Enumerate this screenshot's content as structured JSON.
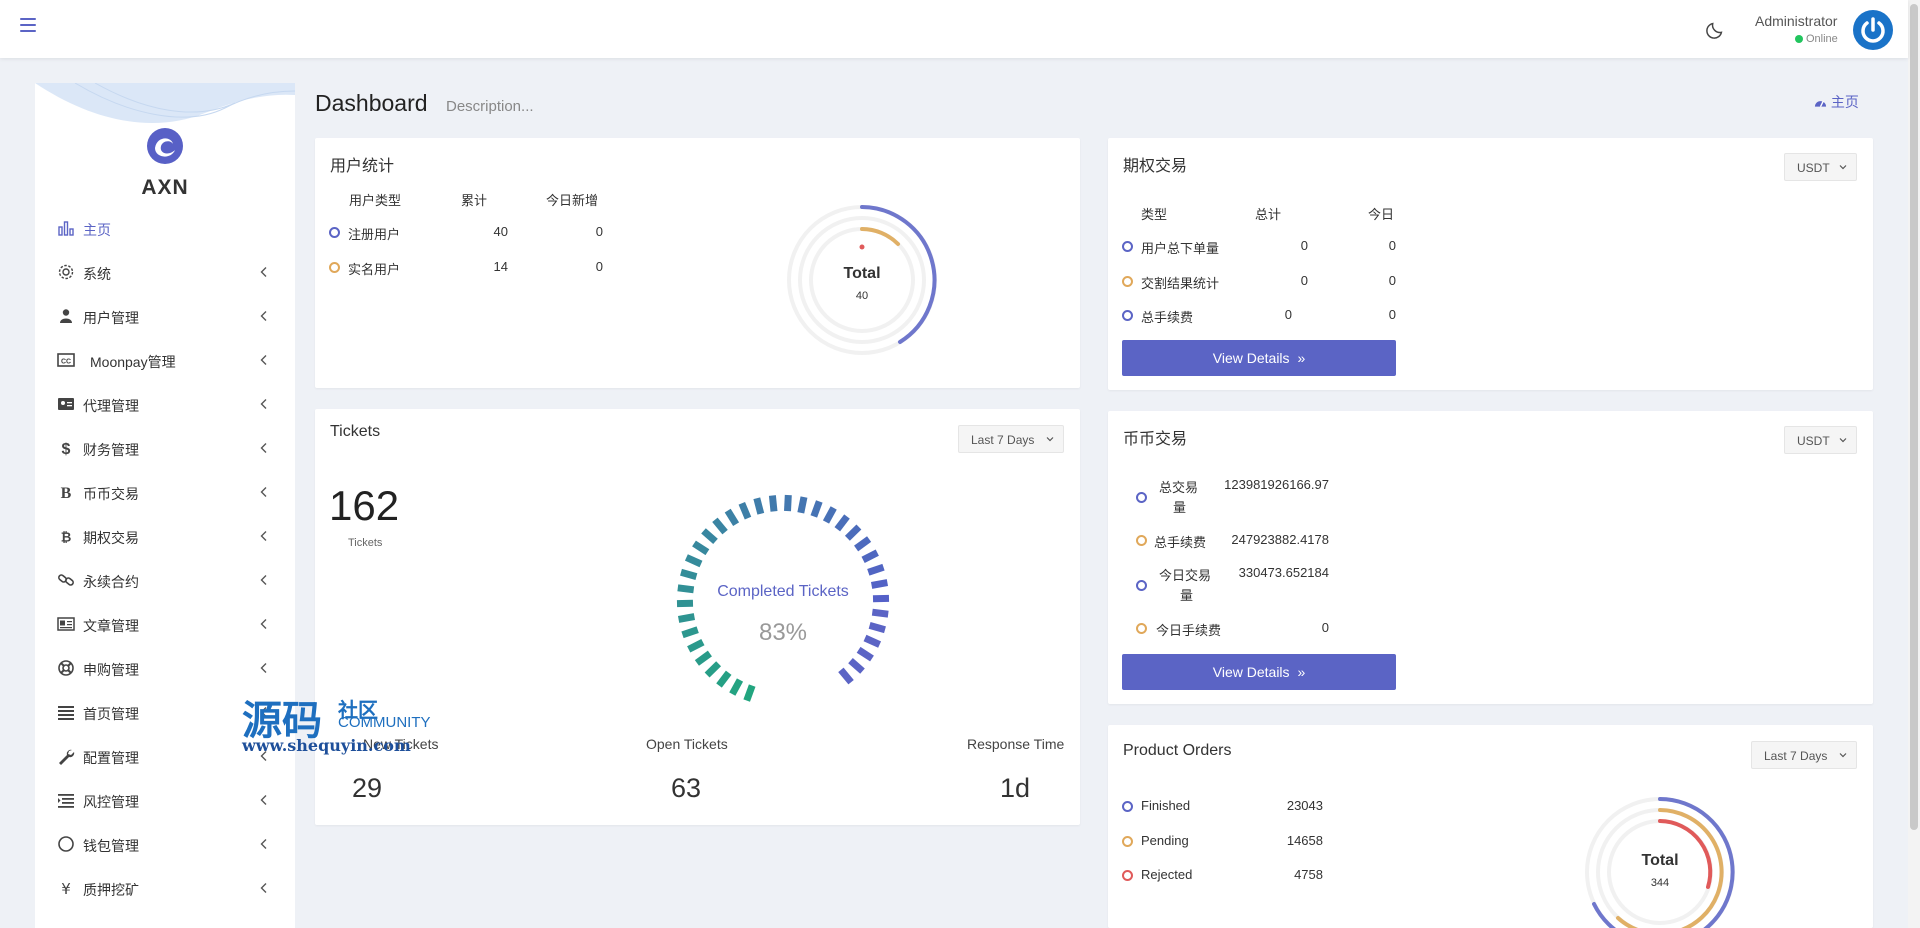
{
  "header": {
    "admin_name": "Administrator",
    "admin_status": "Online"
  },
  "sidebar": {
    "logo_text": "AXN",
    "items": [
      {
        "label": "主页",
        "icon": "bar-chart-icon"
      },
      {
        "label": "系统",
        "icon": "gear-icon"
      },
      {
        "label": "用户管理",
        "icon": "user-icon"
      },
      {
        "label": "Moonpay管理",
        "icon": "cc-icon"
      },
      {
        "label": "代理管理",
        "icon": "id-card-icon"
      },
      {
        "label": "财务管理",
        "icon": "dollar-icon"
      },
      {
        "label": "币币交易",
        "icon": "letter-b-icon"
      },
      {
        "label": "期权交易",
        "icon": "bitcoin-icon"
      },
      {
        "label": "永续合约",
        "icon": "link-icon"
      },
      {
        "label": "文章管理",
        "icon": "newspaper-icon"
      },
      {
        "label": "申购管理",
        "icon": "lifebuoy-icon"
      },
      {
        "label": "首页管理",
        "icon": "list-icon"
      },
      {
        "label": "配置管理",
        "icon": "wrench-icon"
      },
      {
        "label": "风控管理",
        "icon": "list-indent-icon"
      },
      {
        "label": "钱包管理",
        "icon": "circle-icon"
      },
      {
        "label": "质押挖矿",
        "icon": "yen-icon"
      }
    ]
  },
  "page": {
    "title": "Dashboard",
    "description": "Description...",
    "home_link": "主页"
  },
  "user_stats": {
    "title": "用户统计",
    "headers": [
      "用户类型",
      "累计",
      "今日新增"
    ],
    "rows": [
      {
        "label": "注册用户",
        "total": "40",
        "today": "0"
      },
      {
        "label": "实名用户",
        "total": "14",
        "today": "0"
      }
    ],
    "donut_label": "Total",
    "donut_value": "40"
  },
  "options_trade": {
    "title": "期权交易",
    "currency": "USDT",
    "headers": [
      "类型",
      "总计",
      "今日"
    ],
    "rows": [
      {
        "label": "用户总下单量",
        "total": "0",
        "today": "0"
      },
      {
        "label": "交割结果统计",
        "total": "0",
        "today": "0"
      },
      {
        "label": "总手续费",
        "total": "0",
        "today": "0"
      }
    ],
    "button": "View Details"
  },
  "tickets": {
    "title": "Tickets",
    "range": "Last 7 Days",
    "total": "162",
    "total_caption": "Tickets",
    "gauge_label": "Completed Tickets",
    "gauge_value": "83%",
    "gauge_fraction": 0.83,
    "stats": [
      {
        "label": "New Tickets",
        "value": "29"
      },
      {
        "label": "Open Tickets",
        "value": "63"
      },
      {
        "label": "Response Time",
        "value": "1d"
      }
    ]
  },
  "coin_trade": {
    "title": "币币交易",
    "currency": "USDT",
    "rows": [
      {
        "label_1": "总交易",
        "label_2": "量",
        "value": "123981926166.97"
      },
      {
        "label_1": "总手续费",
        "label_2": "",
        "value": "247923882.4178"
      },
      {
        "label_1": "今日交易",
        "label_2": "量",
        "value": "330473.652184"
      },
      {
        "label_1": "今日手续费",
        "label_2": "",
        "value": "0"
      }
    ],
    "button": "View Details"
  },
  "product_orders": {
    "title": "Product Orders",
    "range": "Last 7 Days",
    "rows": [
      {
        "label": "Finished",
        "value": "23043"
      },
      {
        "label": "Pending",
        "value": "14658"
      },
      {
        "label": "Rejected",
        "value": "4758"
      }
    ],
    "donut_label": "Total",
    "donut_value": "344"
  },
  "watermark": {
    "big": "源码",
    "small": "社区",
    "community": "COMMUNITY",
    "url": "www.shequyin.com"
  },
  "colors": {
    "primary": "#5b64c5",
    "orange": "#e0a85a",
    "red": "#e05a5a",
    "green": "#22a57f",
    "online": "#22c55e"
  }
}
